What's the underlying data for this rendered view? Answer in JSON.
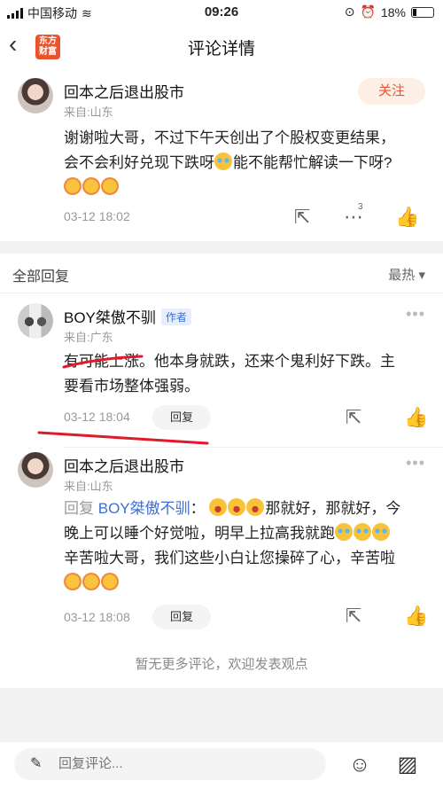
{
  "status_bar": {
    "carrier": "中国移动",
    "time": "09:26",
    "battery": "18%"
  },
  "nav": {
    "title": "评论详情",
    "logo_text": "东方财富"
  },
  "main_post": {
    "username": "回本之后退出股市",
    "from": "来自:山东",
    "follow_label": "关注",
    "text_line1": "谢谢啦大哥，不过下午天创出了个股权变更结果，",
    "text_line2_a": "会不会利好兑现下跌呀",
    "text_line2_b": "能不能帮忙解读一下呀?",
    "time": "03-12 18:02",
    "comment_count": "3"
  },
  "replies": {
    "section_title": "全部回复",
    "sort_label": "最热 ▾",
    "items": [
      {
        "username": "BOY桀傲不驯",
        "author_tag": "作者",
        "from": "来自:广东",
        "text_line1": "有可能上涨。他本身就跌，还来个鬼利好下跌。主",
        "text_line2": "要看市场整体强弱。",
        "time": "03-12 18:04",
        "reply_label": "回复"
      },
      {
        "username": "回本之后退出股市",
        "from": "来自:山东",
        "reply_prefix": "回复",
        "reply_target": "BOY桀傲不驯",
        "colon": "：",
        "text_line1_b": "那就好，那就好，今",
        "text_line2": "晚上可以睡个好觉啦，明早上拉高我就跑",
        "text_line3": "辛苦啦大哥，我们这些小白让您操碎了心，辛苦啦",
        "time": "03-12 18:08",
        "reply_label": "回复"
      }
    ],
    "no_more": "暂无更多评论，欢迎发表观点"
  },
  "bottom_bar": {
    "input_placeholder": "回复评论..."
  },
  "colors": {
    "accent": "#e9542f",
    "link": "#3b6fd6",
    "annotation_red": "#e0192b"
  }
}
